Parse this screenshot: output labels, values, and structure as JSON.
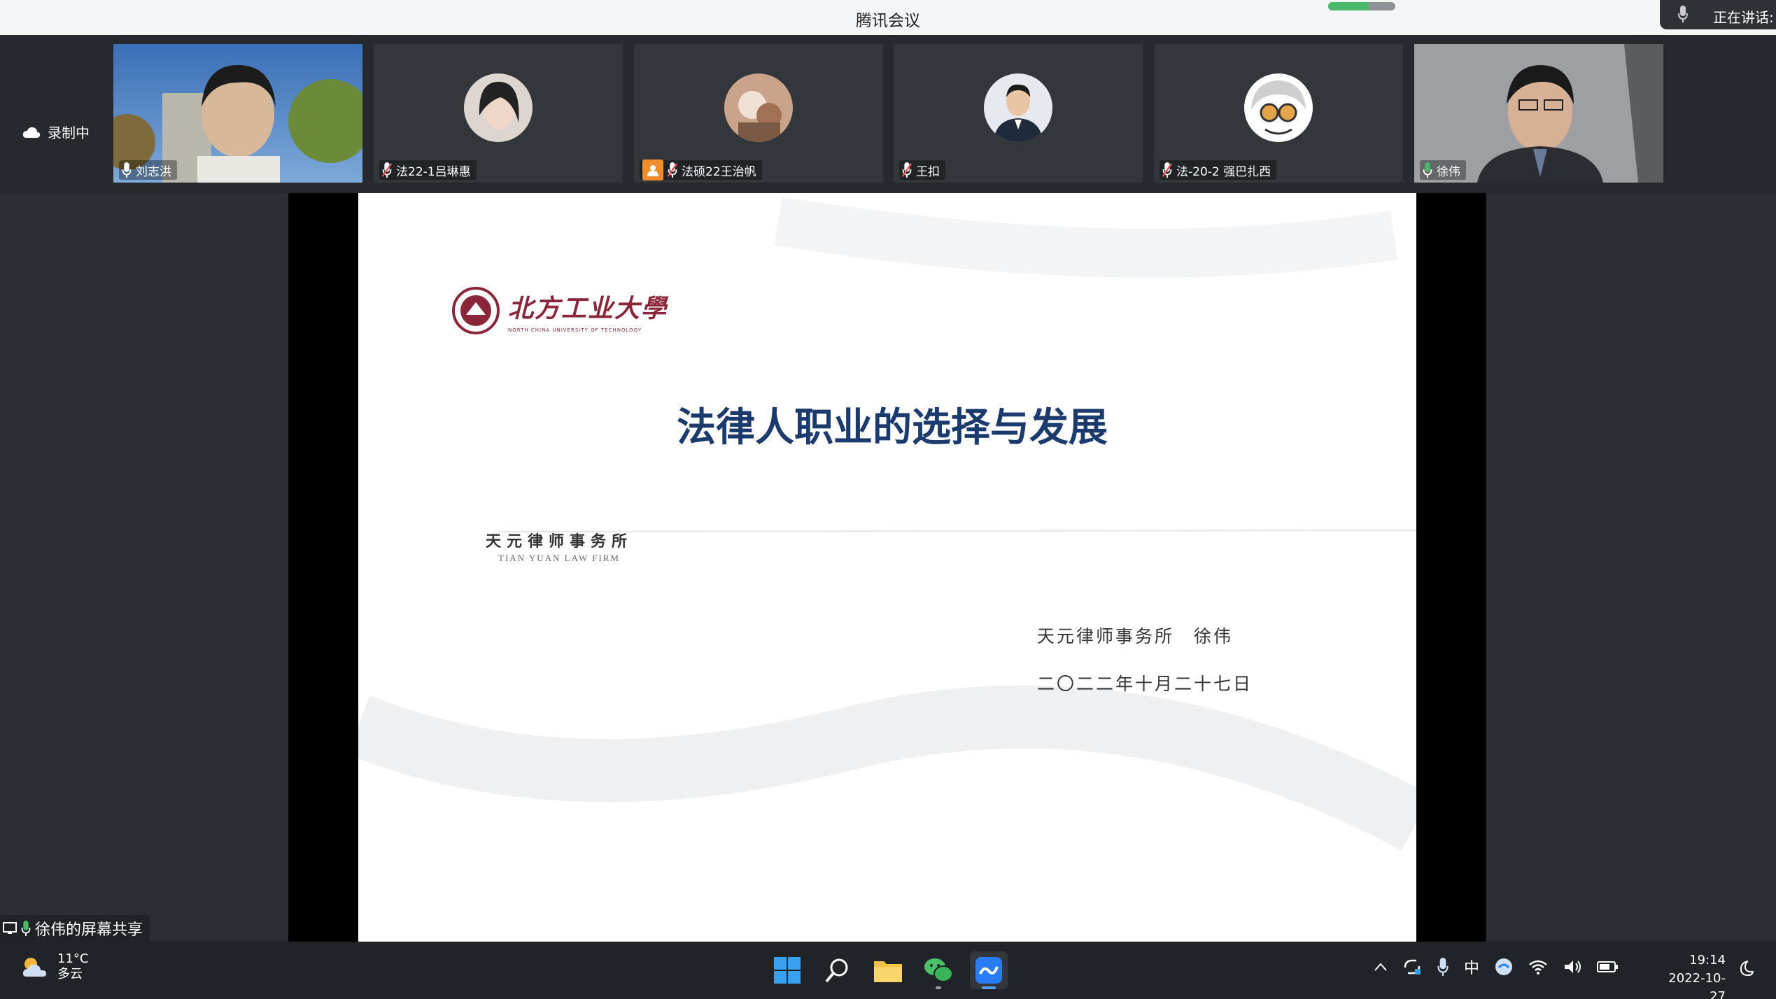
{
  "app": {
    "title": "腾讯会议",
    "speaking_label": "正在讲话:",
    "network_level": 0.6,
    "recording_label": "录制中"
  },
  "participants": [
    {
      "name": "刘志洪",
      "mic": "on",
      "video": true
    },
    {
      "name": "法22-1吕琳惠",
      "mic": "muted",
      "video": false
    },
    {
      "name": "法硕22王治帆",
      "mic": "muted",
      "video": false,
      "badge": "host-icon"
    },
    {
      "name": "王扣",
      "mic": "muted",
      "video": false
    },
    {
      "name": "法-20-2 强巴扎西",
      "mic": "muted",
      "video": false
    },
    {
      "name": "徐伟",
      "mic": "on",
      "video": true
    }
  ],
  "slide": {
    "university_name": "北方工业大學",
    "university_subtitle": "NORTH CHINA UNIVERSITY OF TECHNOLOGY",
    "title": "法律人职业的选择与发展",
    "firm_name_cn": "天元律师事务所",
    "firm_name_en": "TIAN YUAN LAW FIRM",
    "author_line": "天元律师事务所　徐伟",
    "date_line": "二〇二二年十月二十七日"
  },
  "share_label": "徐伟的屏幕共享",
  "taskbar": {
    "weather_temp": "11°C",
    "weather_desc": "多云",
    "ime": "中",
    "time": "19:14",
    "date": "2022-10-27",
    "apps": [
      "windows-start",
      "search",
      "file-explorer",
      "wechat",
      "tencent-meeting"
    ]
  },
  "colors": {
    "slide_title": "#1b3a6e",
    "university": "#8b2539",
    "mic_on": "#4bb96a",
    "mic_muted": "#e24c4c",
    "host_badge": "#f18c2c"
  }
}
